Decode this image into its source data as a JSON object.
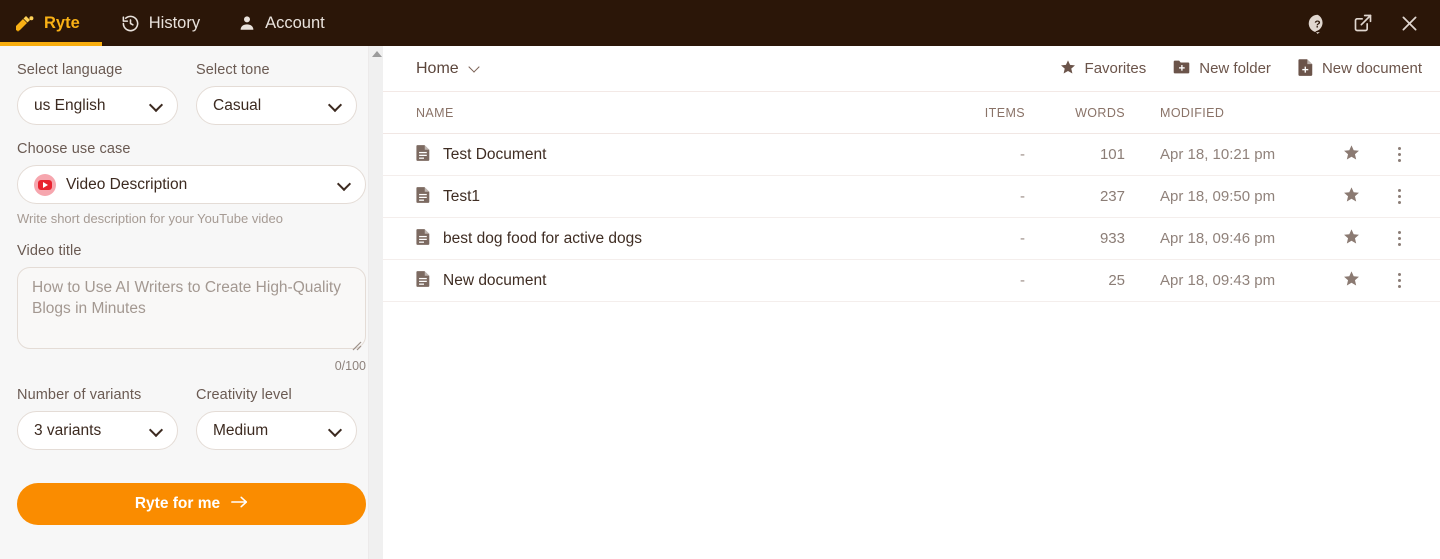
{
  "topbar": {
    "background": "#2b1608",
    "accent": "#f9ae0f",
    "tabs": [
      {
        "label": "Ryte",
        "icon": "ryte-logo-icon",
        "active": true
      },
      {
        "label": "History",
        "icon": "history-clock-icon",
        "active": false
      },
      {
        "label": "Account",
        "icon": "user-account-icon",
        "active": false
      }
    ],
    "right_icons": [
      {
        "name": "help-icon"
      },
      {
        "name": "open-external-icon"
      },
      {
        "name": "close-icon"
      }
    ]
  },
  "sidebar": {
    "language": {
      "label": "Select language",
      "value": "us English"
    },
    "tone": {
      "label": "Select tone",
      "value": "Casual"
    },
    "use_case": {
      "label": "Choose use case",
      "value": "Video Description",
      "icon": "youtube-icon",
      "hint": "Write short description for your YouTube video"
    },
    "video_title": {
      "label": "Video title",
      "value": "",
      "placeholder": "How to Use AI Writers to Create High-Quality Blogs in Minutes",
      "counter": "0/100"
    },
    "variants": {
      "label": "Number of variants",
      "value": "3 variants"
    },
    "creativity": {
      "label": "Creativity level",
      "value": "Medium"
    },
    "submit": {
      "label": "Ryte for me",
      "icon": "arrow-right-icon",
      "color": "#fa8c00"
    }
  },
  "main": {
    "breadcrumb": "Home",
    "actions": [
      {
        "label": "Favorites",
        "icon": "star-icon"
      },
      {
        "label": "New folder",
        "icon": "folder-plus-icon"
      },
      {
        "label": "New document",
        "icon": "document-plus-icon"
      }
    ],
    "table": {
      "columns": [
        "NAME",
        "ITEMS",
        "WORDS",
        "MODIFIED"
      ],
      "rows": [
        {
          "name": "Test Document",
          "items": "-",
          "words": "101",
          "modified": "Apr 18, 10:21 pm"
        },
        {
          "name": "Test1",
          "items": "-",
          "words": "237",
          "modified": "Apr 18, 09:50 pm"
        },
        {
          "name": "best dog food for active dogs",
          "items": "-",
          "words": "933",
          "modified": "Apr 18, 09:46 pm"
        },
        {
          "name": "New document",
          "items": "-",
          "words": "25",
          "modified": "Apr 18, 09:43 pm"
        }
      ]
    }
  }
}
